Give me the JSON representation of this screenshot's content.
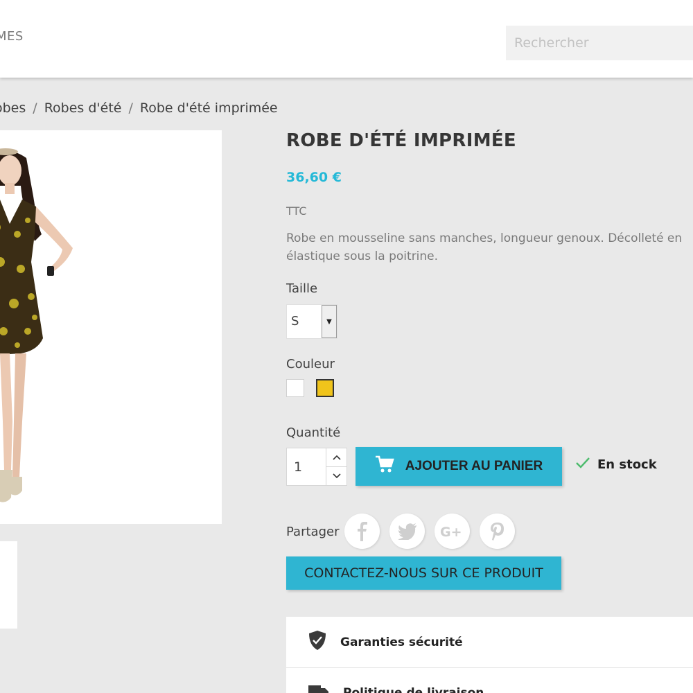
{
  "header": {
    "nav_item": "MES",
    "search_placeholder": "Rechercher"
  },
  "breadcrumb": {
    "items": [
      "obes",
      "Robes d'été",
      "Robe d'été imprimée"
    ],
    "separator": "/"
  },
  "product": {
    "title": "ROBE D'ÉTÉ IMPRIMÉE",
    "price": "36,60 €",
    "tax_label": "TTC",
    "description": "Robe en mousseline sans manches, longueur genoux. Décolleté en élastique sous la poitrine.",
    "size_label": "Taille",
    "size_value": "S",
    "color_label": "Couleur",
    "colors": [
      {
        "name": "blanc",
        "hex": "#ffffff"
      },
      {
        "name": "jaune",
        "hex": "#f0c41b"
      }
    ],
    "quantity_label": "Quantité",
    "quantity_value": "1",
    "add_to_cart_label": "AJOUTER AU PANIER",
    "stock_label": "En stock",
    "share_label": "Partager",
    "contact_label": "CONTACTEZ-NOUS SUR CE PRODUIT"
  },
  "social_icons": [
    "facebook-icon",
    "twitter-icon",
    "google-plus-icon",
    "pinterest-icon"
  ],
  "reassurance": [
    {
      "icon": "shield-icon",
      "label": "Garanties sécurité"
    },
    {
      "icon": "truck-icon",
      "label": "Politique de livraison"
    }
  ],
  "colors": {
    "accent": "#2fb5d2",
    "price": "#25b9d7",
    "stock_check": "#4cbb6c",
    "background": "#e9e9e9"
  }
}
